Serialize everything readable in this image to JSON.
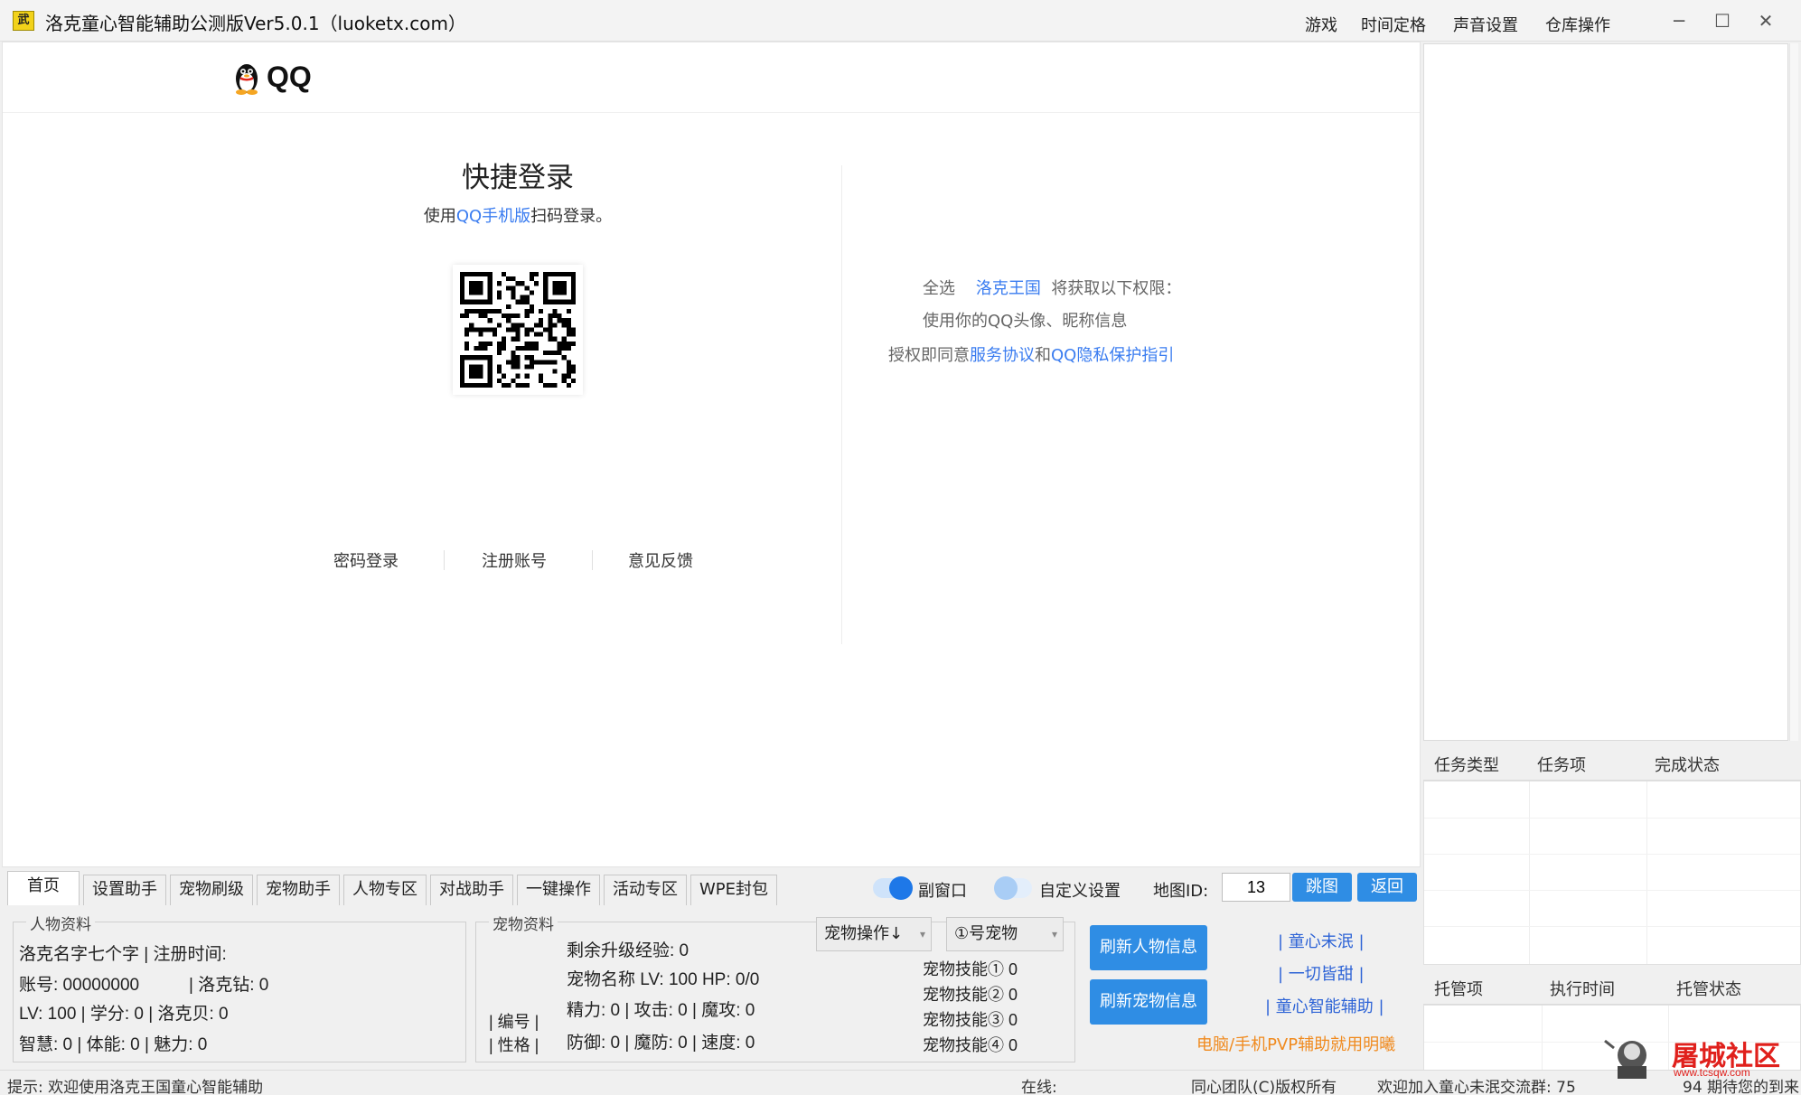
{
  "window": {
    "title": "洛克童心智能辅助公测版Ver5.0.1（luoketx.com）",
    "icon_text": "武",
    "menu": [
      "游戏",
      "时间定格",
      "声音设置",
      "仓库操作"
    ],
    "controls": {
      "minimize": "─",
      "maximize": "☐",
      "close": "✕"
    }
  },
  "qq_login": {
    "logo_text": "QQ",
    "title": "快捷登录",
    "subtitle_prefix": "使用",
    "subtitle_link": "QQ手机版",
    "subtitle_suffix": "扫码登录。",
    "permission": {
      "select_all": "全选",
      "app_name": "洛克王国",
      "obtain_text": "将获取以下权限：",
      "item": "使用你的QQ头像、昵称信息",
      "agree_prefix": "授权即同意",
      "service_link": "服务协议",
      "and": "和",
      "privacy_link": "QQ隐私保护指引"
    },
    "links": [
      "密码登录",
      "注册账号",
      "意见反馈"
    ]
  },
  "right_panel": {
    "task_columns": [
      "任务类型",
      "任务项",
      "完成状态"
    ],
    "hosting_columns": [
      "托管项",
      "执行时间",
      "托管状态"
    ]
  },
  "tabs": [
    "首页",
    "设置助手",
    "宠物刷级",
    "宠物助手",
    "人物专区",
    "对战助手",
    "一键操作",
    "活动专区",
    "WPE封包"
  ],
  "toolbar": {
    "sub_window_label": "副窗口",
    "custom_settings_label": "自定义设置",
    "map_id_label": "地图ID:",
    "map_id_value": "13",
    "jump_button": "跳图",
    "back_button": "返回"
  },
  "person_info": {
    "group_title": "人物资料",
    "line1": "洛克名字七个字 | 注册时间:",
    "account": "账号: 00000000",
    "diamond": "| 洛克钻: 0",
    "line3": "LV: 100 | 学分: 0 | 洛克贝: 0",
    "line4": "智慧: 0 | 体能: 0 | 魅力: 0"
  },
  "pet_info": {
    "group_title": "宠物资料",
    "id_label": "| 编号 |",
    "nature_label": "| 性格 |",
    "exp": "剩余升级经验: 0",
    "name_line": "宠物名称 LV: 100 HP: 0/0",
    "stats1": "精力: 0 | 攻击: 0 | 魔攻: 0",
    "stats2": "防御: 0 | 魔防: 0 | 速度: 0",
    "operation_combo": "宠物操作↓",
    "pet_slot_combo": "①号宠物",
    "skills": [
      "宠物技能① 0",
      "宠物技能② 0",
      "宠物技能③ 0",
      "宠物技能④ 0"
    ]
  },
  "actions": {
    "refresh_person": "刷新人物信息",
    "refresh_pet": "刷新宠物信息",
    "links": [
      "| 童心未泯 |",
      "| 一切皆甜 |",
      "| 童心智能辅助 |"
    ],
    "promo": "电脑/手机PVP辅助就用明曦"
  },
  "status_bar": {
    "tip": "提示: 欢迎使用洛克王国童心智能辅助",
    "online": "在线:",
    "copyright": "同心团队(C)版权所有",
    "welcome": "欢迎加入童心未泯交流群: 75",
    "welcome_tail": "94 期待您的到来"
  },
  "watermark": {
    "text": "屠城社区",
    "sub": "www.tcsqw.com"
  },
  "colors": {
    "accent": "#2f8de4",
    "link": "#3a7cf0",
    "promo": "#f08a1e",
    "watermark": "#e0201c"
  }
}
